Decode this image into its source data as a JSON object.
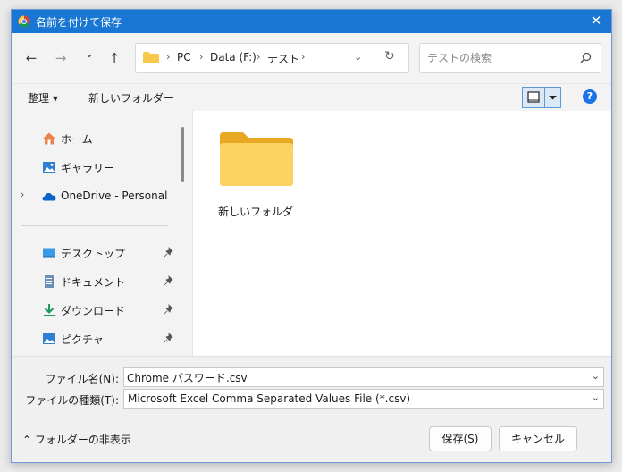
{
  "window": {
    "title": "名前を付けて保存",
    "close_glyph": "✕"
  },
  "nav": {
    "back_glyph": "←",
    "forward_glyph": "→",
    "recent_glyph": "⌄",
    "up_glyph": "↑"
  },
  "address": {
    "crumbs": [
      "PC",
      "Data (F:)",
      "テスト"
    ],
    "separator": "›",
    "dropdown_glyph": "⌄",
    "refresh_glyph": "↻"
  },
  "search": {
    "placeholder": "テストの検索",
    "value": ""
  },
  "commands": {
    "organize": "整理 ▾",
    "new_folder": "新しいフォルダー",
    "help": "?"
  },
  "sidebar": {
    "items": [
      {
        "label": "ホーム",
        "icon": "home-icon",
        "pinned": false
      },
      {
        "label": "ギャラリー",
        "icon": "gallery-icon",
        "pinned": false
      },
      {
        "label": "OneDrive - Personal",
        "icon": "onedrive-icon",
        "pinned": false,
        "expandable": true,
        "chevron": "›"
      },
      {
        "label": "デスクトップ",
        "icon": "desktop-icon",
        "pinned": true
      },
      {
        "label": "ドキュメント",
        "icon": "documents-icon",
        "pinned": true
      },
      {
        "label": "ダウンロード",
        "icon": "downloads-icon",
        "pinned": true
      },
      {
        "label": "ピクチャ",
        "icon": "pictures-icon",
        "pinned": true
      }
    ]
  },
  "content": {
    "items": [
      {
        "name": "新しいフォルダ",
        "type": "folder-icon"
      }
    ]
  },
  "footer": {
    "filename_label": "ファイル名(N):",
    "filename_value": "Chrome パスワード.csv",
    "filetype_label": "ファイルの種類(T):",
    "filetype_value": "Microsoft Excel Comma Separated Values File (*.csv)",
    "dropdown_glyph": "⌄",
    "toggle_folders": "⌃  フォルダーの非表示",
    "save": "保存(S)",
    "cancel": "キャンセル"
  },
  "colors": {
    "titlebar": "#1976d2",
    "accent": "#1a73e8",
    "folder": "#f8c84a"
  }
}
